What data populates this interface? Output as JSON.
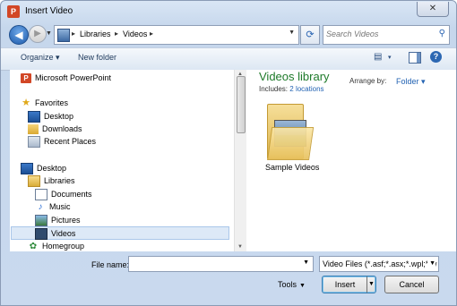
{
  "window": {
    "title": "Insert Video",
    "app_icon_letter": "P",
    "close_glyph": "✕"
  },
  "nav": {
    "back_glyph": "◀",
    "forward_glyph": "▶",
    "history_glyph": "▼",
    "breadcrumb": [
      "Libraries",
      "Videos"
    ],
    "crumb_sep": "▸",
    "refresh_glyph": "⟳",
    "search_placeholder": "Search Videos",
    "search_glyph": "⚲"
  },
  "toolbar": {
    "organize": "Organize ▾",
    "new_folder": "New folder",
    "view_glyph": "▤",
    "dropdown_glyph": "▾",
    "help_glyph": "?"
  },
  "sidebar": {
    "items": [
      {
        "label": "Microsoft PowerPoint",
        "icon": "powerpoint-icon"
      },
      {
        "label": "Favorites",
        "icon": "star-icon"
      },
      {
        "label": "Desktop",
        "icon": "desktop-icon"
      },
      {
        "label": "Downloads",
        "icon": "downloads-icon"
      },
      {
        "label": "Recent Places",
        "icon": "recent-places-icon"
      },
      {
        "label": "Desktop",
        "icon": "desktop-icon"
      },
      {
        "label": "Libraries",
        "icon": "libraries-icon"
      },
      {
        "label": "Documents",
        "icon": "documents-icon"
      },
      {
        "label": "Music",
        "icon": "music-icon"
      },
      {
        "label": "Pictures",
        "icon": "pictures-icon"
      },
      {
        "label": "Videos",
        "icon": "videos-icon"
      },
      {
        "label": "Homegroup",
        "icon": "homegroup-icon"
      }
    ],
    "selected_index": 10,
    "star_glyph": "★",
    "music_glyph": "♪",
    "homegroup_glyph": "✿"
  },
  "content": {
    "library_title": "Videos library",
    "includes_label": "Includes:",
    "includes_link": "2 locations",
    "arrange_label": "Arrange by:",
    "arrange_value": "Folder ▾",
    "items": [
      {
        "label": "Sample Videos",
        "icon": "folder-icon"
      }
    ]
  },
  "footer": {
    "file_name_label": "File name:",
    "file_name_value": "",
    "file_type": "Video Files (*.asf;*.asx;*.wpl;*.w",
    "dropdown_glyph": "▼",
    "tools_label": "Tools",
    "insert_label": "Insert",
    "cancel_label": "Cancel"
  },
  "colors": {
    "accent": "#2363b3",
    "library_title": "#1e7a2a",
    "selection": "#dde9f7"
  }
}
